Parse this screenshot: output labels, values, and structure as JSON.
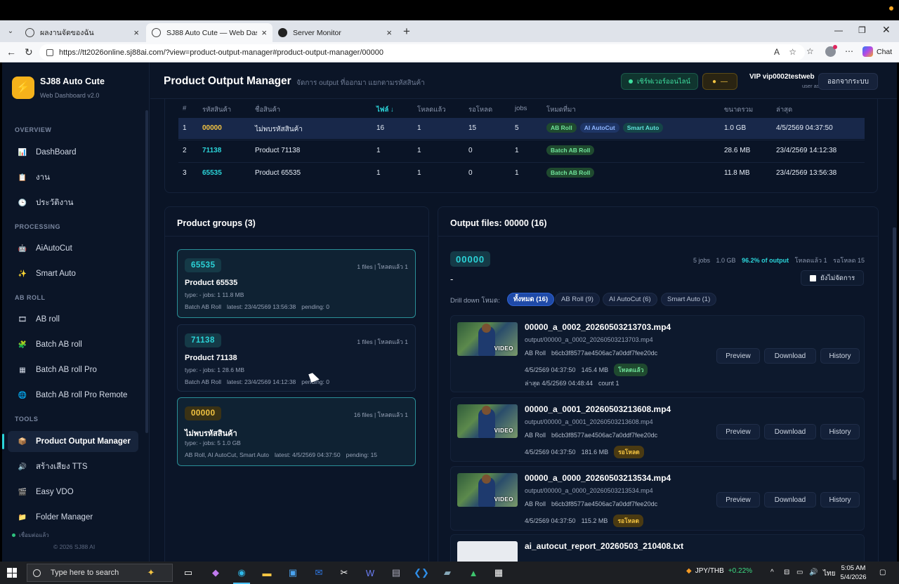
{
  "browser": {
    "tabs": [
      {
        "title": "ผลงานจัดของฉัน",
        "active": false
      },
      {
        "title": "SJ88 Auto Cute — Web Dashboard",
        "active": true
      },
      {
        "title": "Server Monitor",
        "active": false
      }
    ],
    "url": "https://tt2026online.sj88ai.com/?view=product-output-manager#product-output-manager/00000",
    "chat_label": "Chat"
  },
  "sidebar": {
    "brand": "SJ88 Auto Cute",
    "brand_sub": "Web Dashboard v2.0",
    "sections": {
      "overview": "OVERVIEW",
      "processing": "PROCESSING",
      "abroll": "AB ROLL",
      "tools": "TOOLS"
    },
    "items": [
      {
        "label": "DashBoard",
        "icon": "chart-icon"
      },
      {
        "label": "งาน",
        "icon": "clipboard-icon"
      },
      {
        "label": "ประวัติงาน",
        "icon": "clock-icon"
      },
      {
        "label": "AiAutoCut",
        "icon": "robot-icon"
      },
      {
        "label": "Smart Auto",
        "icon": "sparkle-icon"
      },
      {
        "label": "AB roll",
        "icon": "film-icon"
      },
      {
        "label": "Batch AB roll",
        "icon": "puzzle-icon"
      },
      {
        "label": "Batch AB roll Pro",
        "icon": "grid-icon"
      },
      {
        "label": "Batch AB roll Pro Remote",
        "icon": "globe-icon"
      },
      {
        "label": "Product Output Manager",
        "icon": "box-icon",
        "active": true
      },
      {
        "label": "สร้างเสียง TTS",
        "icon": "speaker-icon"
      },
      {
        "label": "Easy VDO",
        "icon": "video-icon"
      },
      {
        "label": "Folder Manager",
        "icon": "folder-icon"
      }
    ],
    "footer_status": "เชื่อมต่อแล้ว",
    "footer_copy": "© 2026 SJ88 AI"
  },
  "header": {
    "title": "Product Output Manager",
    "subtitle": "จัดการ output ที่ออกมา แยกตามรหัสสินค้า",
    "online": "เซิร์ฟเวอร์ออนไลน์",
    "coin": "—",
    "vip": "VIP vip0002testweb",
    "vip_sub": "user as free",
    "logout": "ออกจากระบบ"
  },
  "table": {
    "headers": [
      "#",
      "รหัสสินค้า",
      "ชื่อสินค้า",
      "ไฟล์ ↓",
      "โหลดแล้ว",
      "รอโหลด",
      "jobs",
      "โหมดที่มา",
      "ขนาดรวม",
      "ล่าสุด"
    ],
    "rows": [
      {
        "n": "1",
        "code": "00000",
        "name": "ไม่พบรหัสสินค้า",
        "files": "16",
        "loaded": "1",
        "pending": "15",
        "jobs": "5",
        "modes": [
          "AB Roll",
          "AI AutoCut",
          "Smart Auto"
        ],
        "size": "1.0 GB",
        "latest": "4/5/2569 04:37:50"
      },
      {
        "n": "2",
        "code": "71138",
        "name": "Product 71138",
        "files": "1",
        "loaded": "1",
        "pending": "0",
        "jobs": "1",
        "modes": [
          "Batch AB Roll"
        ],
        "size": "28.6 MB",
        "latest": "23/4/2569 14:12:38"
      },
      {
        "n": "3",
        "code": "65535",
        "name": "Product 65535",
        "files": "1",
        "loaded": "1",
        "pending": "0",
        "jobs": "1",
        "modes": [
          "Batch AB Roll"
        ],
        "size": "11.8 MB",
        "latest": "23/4/2569 13:56:38"
      }
    ]
  },
  "groups": {
    "title": "Product groups (3)",
    "items": [
      {
        "code": "65535",
        "meta": "1 files | โหลดแล้ว 1",
        "name": "Product 65535",
        "l1": "type: -   jobs: 1   11.8 MB",
        "modes": "Batch AB Roll",
        "latest": "latest: 23/4/2569 13:56:38",
        "pending": "pending: 0"
      },
      {
        "code": "71138",
        "meta": "1 files | โหลดแล้ว 1",
        "name": "Product 71138",
        "l1": "type: -   jobs: 1   28.6 MB",
        "modes": "Batch AB Roll",
        "latest": "latest: 23/4/2569 14:12:38",
        "pending": "pending: 0"
      },
      {
        "code": "00000",
        "meta": "16 files | โหลดแล้ว 1",
        "name": "ไม่พบรหัสสินค้า",
        "l1": "type: -   jobs: 5   1.0 GB",
        "modes": "AB Roll, AI AutoCut, Smart Auto",
        "latest": "latest: 4/5/2569 04:37:50",
        "pending": "pending: 15"
      }
    ]
  },
  "output": {
    "title": "Output files: 00000 (16)",
    "code": "00000",
    "stats": {
      "jobs": "5 jobs",
      "size": "1.0 GB",
      "percent": "96.2% of output",
      "loaded": "โหลดแล้ว 1",
      "pending": "รอโหลด 15"
    },
    "dash": "-",
    "unorganized": "ยังไม่จัดการ",
    "drill_label": "Drill down โหมด:",
    "chips": [
      "ทั้งหมด (16)",
      "AB Roll (9)",
      "AI AutoCut (6)",
      "Smart Auto (1)"
    ],
    "buttons": {
      "preview": "Preview",
      "download": "Download",
      "history": "History"
    },
    "video_tag": "VIDEO",
    "files": [
      {
        "name": "00000_a_0002_20260503213703.mp4",
        "path": "output/00000_a_0002_20260503213703.mp4",
        "mode": "AB Roll",
        "hash": "b6cb3f8577ae4506ac7a0ddf7fee20dc",
        "date": "4/5/2569 04:37:50",
        "size": "145.4 MB",
        "status": "โหลดแล้ว",
        "last": "ล่าสุด 4/5/2569 04:48:44",
        "count": "count 1"
      },
      {
        "name": "00000_a_0001_20260503213608.mp4",
        "path": "output/00000_a_0001_20260503213608.mp4",
        "mode": "AB Roll",
        "hash": "b6cb3f8577ae4506ac7a0ddf7fee20dc",
        "date": "4/5/2569 04:37:50",
        "size": "181.6 MB",
        "status": "รอโหลด"
      },
      {
        "name": "00000_a_0000_20260503213534.mp4",
        "path": "output/00000_a_0000_20260503213534.mp4",
        "mode": "AB Roll",
        "hash": "b6cb3f8577ae4506ac7a0ddf7fee20dc",
        "date": "4/5/2569 04:37:50",
        "size": "115.2 MB",
        "status": "รอโหลด"
      },
      {
        "name": "ai_autocut_report_20260503_210408.txt"
      }
    ]
  },
  "taskbar": {
    "search": "Type here to search",
    "fx_pair": "JPY/THB",
    "fx_change": "+0.22%",
    "lang": "ไทย",
    "time": "5:05 AM",
    "date": "5/4/2026"
  }
}
